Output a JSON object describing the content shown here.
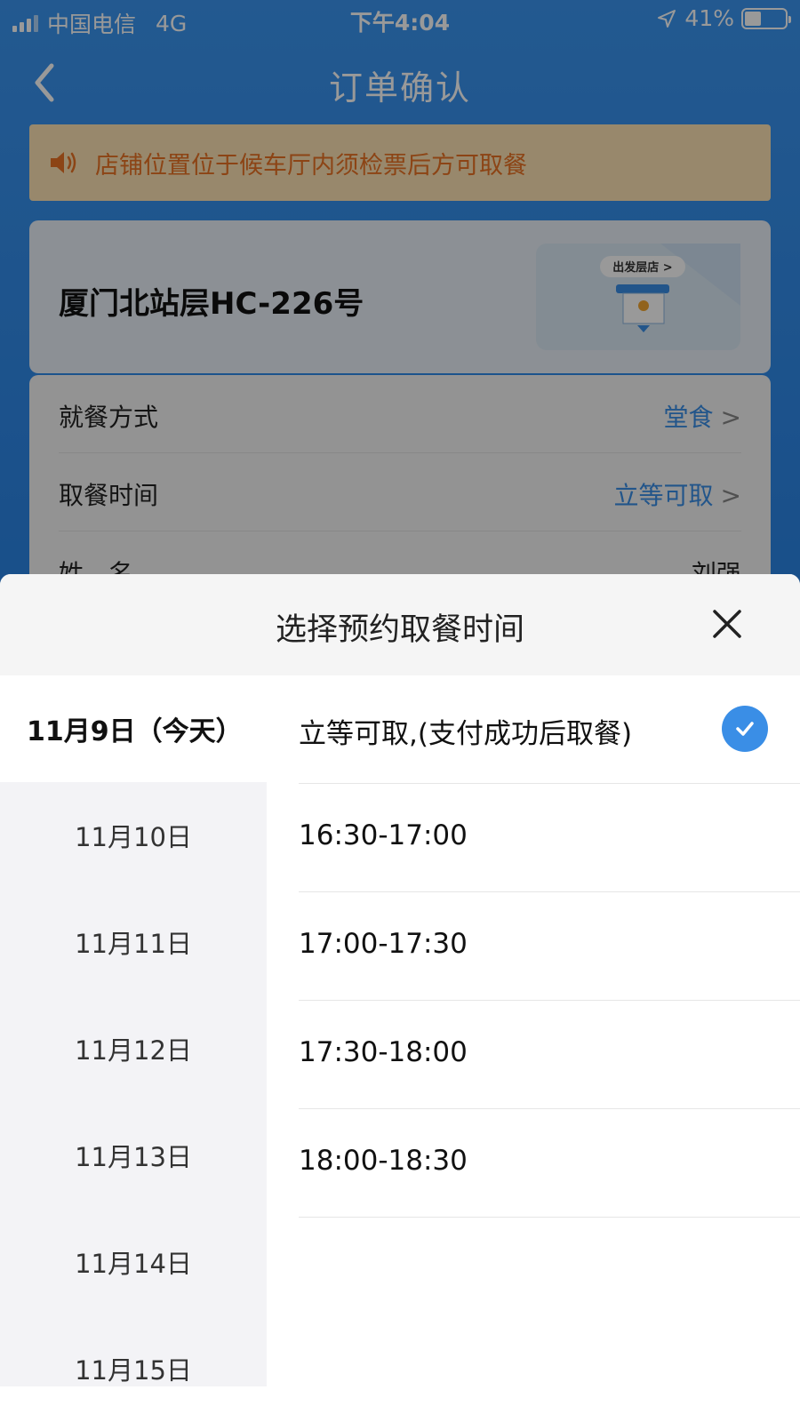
{
  "status_bar": {
    "carrier": "中国电信",
    "network": "4G",
    "time": "下午4:04",
    "battery": "41%",
    "battery_level": 0.41
  },
  "nav": {
    "title": "订单确认"
  },
  "notice": {
    "text": "店铺位置位于候车厅内须检票后方可取餐"
  },
  "store": {
    "name": "厦门北站层HC-226号",
    "badge": "出发层店 >"
  },
  "order_info": [
    {
      "label": "就餐方式",
      "value": "堂食",
      "arrow": ">"
    },
    {
      "label": "取餐时间",
      "value": "立等可取",
      "arrow": ">"
    },
    {
      "label": "姓　名",
      "value": "刘强"
    }
  ],
  "sheet": {
    "title": "选择预约取餐时间",
    "dates": [
      {
        "label": "11月9日（今天）",
        "active": true
      },
      {
        "label": "11月10日"
      },
      {
        "label": "11月11日"
      },
      {
        "label": "11月12日"
      },
      {
        "label": "11月13日"
      },
      {
        "label": "11月14日"
      },
      {
        "label": "11月15日"
      }
    ],
    "slots": [
      {
        "label": "立等可取,(支付成功后取餐)",
        "selected": true
      },
      {
        "label": "16:30-17:00"
      },
      {
        "label": "17:00-17:30"
      },
      {
        "label": "17:30-18:00"
      },
      {
        "label": "18:00-18:30"
      }
    ]
  },
  "colors": {
    "primary": "#3a8ee6",
    "notice_bg": "#fde3b5",
    "notice_text": "#e97223"
  }
}
